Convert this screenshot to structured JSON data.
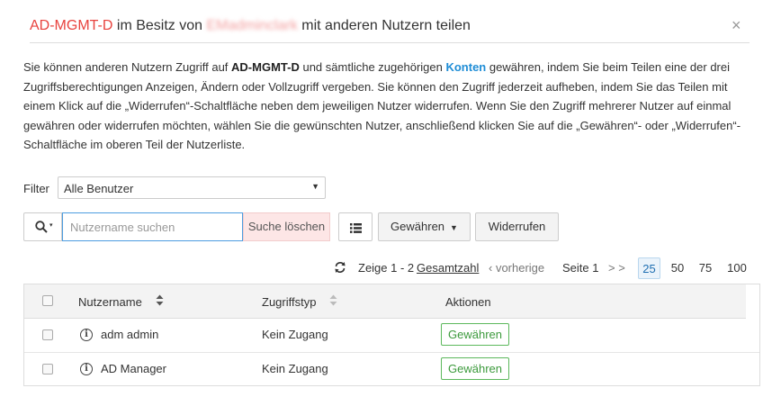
{
  "dialog": {
    "title_object": "AD-MGMT-D",
    "title_mid": " im Besitz von ",
    "title_owner": "EMadminclark",
    "title_end": " mit anderen Nutzern teilen",
    "close_glyph": "×"
  },
  "description": {
    "p1": "Sie können anderen Nutzern Zugriff auf ",
    "p1_bold": "AD-MGMT-D",
    "p2": " und sämtliche zugehörigen ",
    "p2_link": "Konten",
    "p3": " gewähren, indem Sie beim Teilen eine der drei Zugriffsberechtigungen Anzeigen, Ändern oder Vollzugriff vergeben. Sie können den Zugriff jederzeit aufheben, indem Sie das Teilen mit einem Klick auf die „Widerrufen“-Schaltfläche neben dem jeweiligen Nutzer widerrufen. Wenn Sie den Zugriff mehrerer Nutzer auf einmal gewähren oder widerrufen möchten, wählen Sie die gewünschten Nutzer, anschließend klicken Sie auf die „Gewähren“- oder „Widerrufen“-Schaltfläche im oberen Teil der Nutzerliste."
  },
  "filter": {
    "label": "Filter",
    "selected": "Alle Benutzer"
  },
  "search": {
    "placeholder": "Nutzername suchen",
    "clear_label": "Suche löschen"
  },
  "toolbar": {
    "grant_label": "Gewähren",
    "revoke_label": "Widerrufen"
  },
  "pagination": {
    "showing": "Zeige 1 - 2",
    "total_link": "Gesamtzahl",
    "prev": "‹ vorherige",
    "page": "Seite 1",
    "next": "> >",
    "page_sizes": [
      "25",
      "50",
      "75",
      "100"
    ],
    "active_size": "25"
  },
  "table": {
    "columns": {
      "name": "Nutzername",
      "access": "Zugriffstyp",
      "actions": "Aktionen"
    },
    "rows": [
      {
        "name": "adm admin",
        "access": "Kein Zugang",
        "action": "Gewähren"
      },
      {
        "name": "AD Manager",
        "access": "Kein Zugang",
        "action": "Gewähren"
      }
    ]
  },
  "colors": {
    "accent_red": "#e8433e",
    "link_blue": "#1f8dd6",
    "grant_green": "#5cb85c"
  }
}
